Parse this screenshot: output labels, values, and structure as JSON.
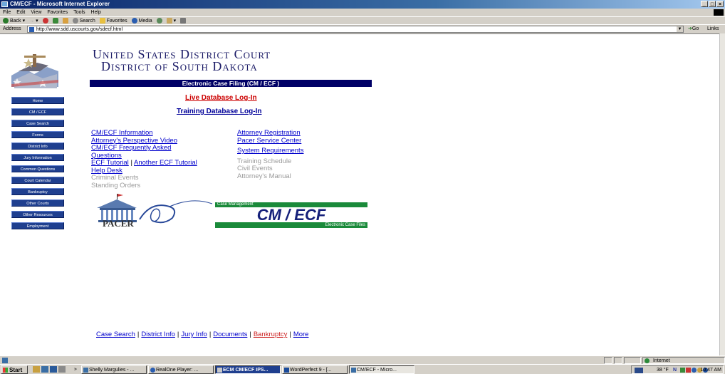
{
  "window": {
    "title": "CM/ECF - Microsoft Internet Explorer",
    "controls": [
      "_",
      "□",
      "×"
    ]
  },
  "menu": [
    "File",
    "Edit",
    "View",
    "Favorites",
    "Tools",
    "Help"
  ],
  "toolbar": {
    "back": "Back",
    "search": "Search",
    "favorites": "Favorites",
    "media": "Media"
  },
  "address": {
    "label": "Address",
    "url": "http://www.sdd.uscourts.gov/sdecf.html",
    "go": "Go",
    "links": "Links"
  },
  "page": {
    "court_line1": "United States District Court",
    "court_line2": "District of South Dakota",
    "banner": "Electronic Case Filing (CM / ECF )",
    "live_login": "Live Database Log-In",
    "training_login": "Training Database Log-In",
    "sidebar": [
      "Home",
      "CM / ECF",
      "Case Search",
      "Forms",
      "District Info",
      "Jury Information",
      "Common Questions",
      "Court Calendar",
      "Bankruptcy",
      "Other Courts",
      "Other Resources",
      "Employment"
    ],
    "col1": {
      "cmecf_info": "CM/ECF Information",
      "attorney_video": "Attorney's Perspective Video",
      "faq_line1": "CM/ECF Frequently Asked",
      "faq_line2": "Questions",
      "ecf_tutorial": "ECF Tutorial",
      "sep": "|",
      "another_tutorial": "Another ECF Tutorial",
      "help_desk": "Help Desk",
      "criminal_events": "Criminal Events",
      "standing_orders": "Standing Orders"
    },
    "col2": {
      "attorney_registration": "Attorney Registration",
      "pacer_center": "Pacer Service Center",
      "system_requirements": "System Requirements",
      "training_schedule": "Training Schedule",
      "civil_events": "Civil Events",
      "attorney_manual": "Attorney's Manual"
    },
    "pacer_logo_text": "PACER",
    "cmecf_logo": {
      "top": "Case Management",
      "main": "CM / ECF",
      "bottom": "Electronic Case Files"
    },
    "footer": {
      "case_search": "Case Search",
      "district_info": "District Info",
      "jury_info": "Jury Info",
      "documents": "Documents",
      "bankruptcy": "Bankruptcy",
      "more": "More",
      "sep": "|"
    }
  },
  "status": {
    "zone": "Internet"
  },
  "taskbar": {
    "start": "Start",
    "tasks": [
      {
        "label": "Shelly Margulies - ...",
        "state": "normal"
      },
      {
        "label": "RealOne Player: ...",
        "state": "normal"
      },
      {
        "label": "ECM CM/ECF IPS...",
        "state": "active"
      },
      {
        "label": "WordPerfect 9 - [...",
        "state": "normal"
      },
      {
        "label": "CM/ECF - Micro...",
        "state": "pressed"
      }
    ],
    "overflow": "»",
    "temperature": "38 °F",
    "n_label": "N",
    "clock": "10:47 AM"
  },
  "colors": {
    "navy": "#000066",
    "sidebar_blue": "#1f3f8f",
    "link_blue": "#0000cc",
    "live_red": "#cc0000",
    "ecf_green": "#1a8a3a"
  }
}
